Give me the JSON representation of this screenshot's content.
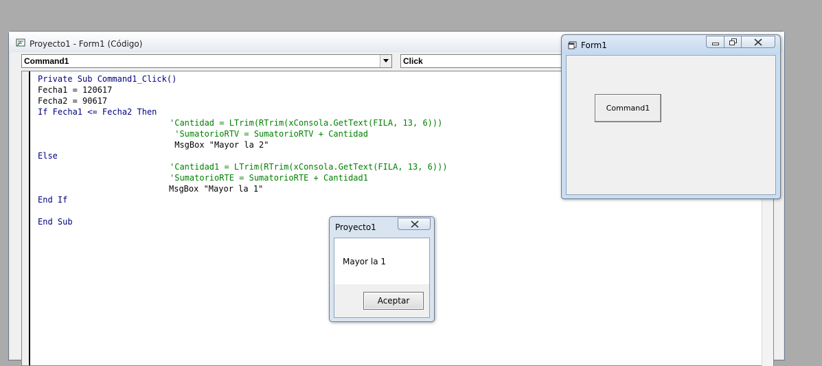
{
  "code_window": {
    "title": "Proyecto1 - Form1 (Código)",
    "object_combo": "Command1",
    "procedure_combo": "Click",
    "lines": [
      {
        "text": "Private Sub Command1_Click()",
        "kind": "kw"
      },
      {
        "text": "Fecha1 = 120617",
        "kind": "plain"
      },
      {
        "text": "Fecha2 = 90617",
        "kind": "plain"
      },
      {
        "text": "If Fecha1 <= Fecha2 Then",
        "kind": "kw"
      },
      {
        "text": "'Cantidad = LTrim(RTrim(xConsola.GetText(FILA, 13, 6)))",
        "kind": "comment"
      },
      {
        "text": " 'SumatorioRTV = SumatorioRTV + Cantidad",
        "kind": "comment"
      },
      {
        "text": " MsgBox \"Mayor la 2\"",
        "kind": "plain"
      },
      {
        "text": "Else",
        "kind": "kw"
      },
      {
        "text": "'Cantidad1 = LTrim(RTrim(xConsola.GetText(FILA, 13, 6)))",
        "kind": "comment"
      },
      {
        "text": "'SumatorioRTE = SumatorioRTE + Cantidad1",
        "kind": "comment"
      },
      {
        "text": "MsgBox \"Mayor la 1\"",
        "kind": "plain"
      },
      {
        "text": "End If",
        "kind": "kw"
      },
      {
        "text": "",
        "kind": "plain"
      },
      {
        "text": "End Sub",
        "kind": "kw"
      }
    ]
  },
  "form_window": {
    "title": "Form1",
    "button_label": "Command1"
  },
  "msgbox": {
    "title": "Proyecto1",
    "message": "Mayor la 1",
    "ok_label": "Aceptar"
  },
  "colors": {
    "keyword": "#00007f",
    "comment": "#008000",
    "desktop": "#ababab"
  }
}
